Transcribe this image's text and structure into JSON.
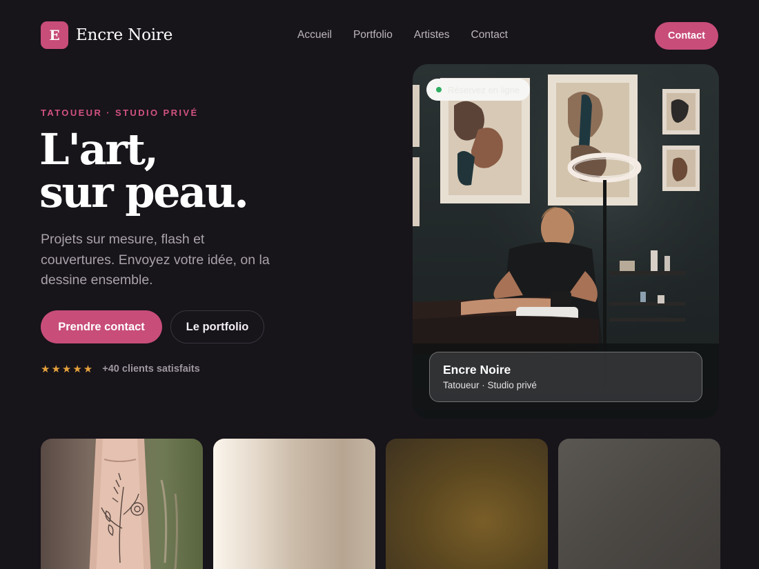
{
  "brand": {
    "mark": "E",
    "name": "Encre Noire"
  },
  "nav": {
    "items": [
      {
        "label": "Accueil"
      },
      {
        "label": "Portfolio"
      },
      {
        "label": "Artistes"
      },
      {
        "label": "Contact"
      }
    ],
    "cta_label": "Contact"
  },
  "hero": {
    "eyebrow": "Tatoueur · Studio privé",
    "title_line1": "L'art,",
    "title_line2": "sur peau.",
    "lead": "Projets sur mesure, flash et couvertures. Envoyez votre idée, on la dessine ensemble.",
    "primary_label": "Prendre contact",
    "secondary_label": "Le portfolio",
    "stars": "★★★★★",
    "rating_value": 5,
    "rating_text": "+40 clients satisfaits"
  },
  "photo": {
    "status": "Réservez en ligne",
    "caption_title": "Encre Noire",
    "caption_sub": "Tatoueur · Studio privé"
  },
  "colors": {
    "background": "#17141a",
    "accent": "#c84d79",
    "star": "#e6a23c",
    "status_dot": "#2fae62"
  }
}
